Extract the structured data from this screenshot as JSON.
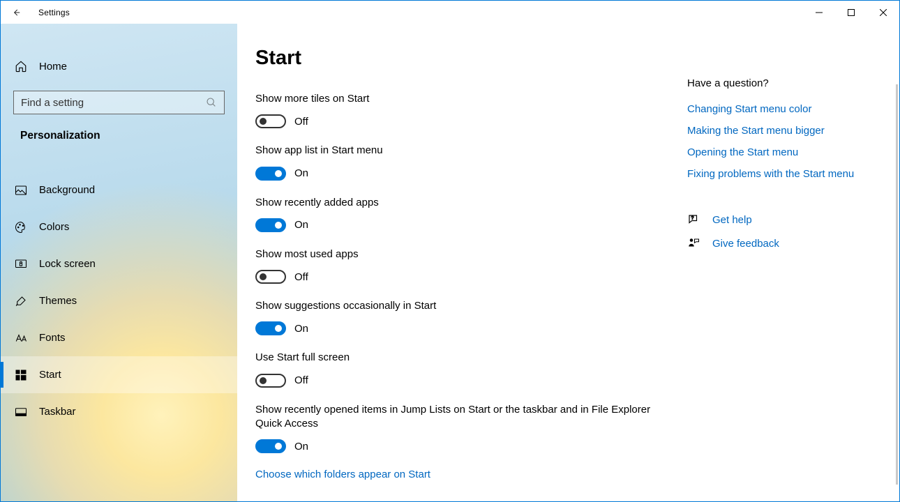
{
  "window": {
    "title": "Settings"
  },
  "sidebar": {
    "home": "Home",
    "search_placeholder": "Find a setting",
    "category": "Personalization",
    "items": [
      {
        "label": "Background"
      },
      {
        "label": "Colors"
      },
      {
        "label": "Lock screen"
      },
      {
        "label": "Themes"
      },
      {
        "label": "Fonts"
      },
      {
        "label": "Start"
      },
      {
        "label": "Taskbar"
      }
    ]
  },
  "page": {
    "title": "Start",
    "settings": [
      {
        "label": "Show more tiles on Start",
        "on": false
      },
      {
        "label": "Show app list in Start menu",
        "on": true
      },
      {
        "label": "Show recently added apps",
        "on": true
      },
      {
        "label": "Show most used apps",
        "on": false
      },
      {
        "label": "Show suggestions occasionally in Start",
        "on": true
      },
      {
        "label": "Use Start full screen",
        "on": false
      },
      {
        "label": "Show recently opened items in Jump Lists on Start or the taskbar and in File Explorer Quick Access",
        "on": true
      }
    ],
    "toggle_labels": {
      "on": "On",
      "off": "Off"
    },
    "folders_link": "Choose which folders appear on Start"
  },
  "aside": {
    "heading": "Have a question?",
    "links": [
      "Changing Start menu color",
      "Making the Start menu bigger",
      "Opening the Start menu",
      "Fixing problems with the Start menu"
    ],
    "get_help": "Get help",
    "give_feedback": "Give feedback"
  }
}
